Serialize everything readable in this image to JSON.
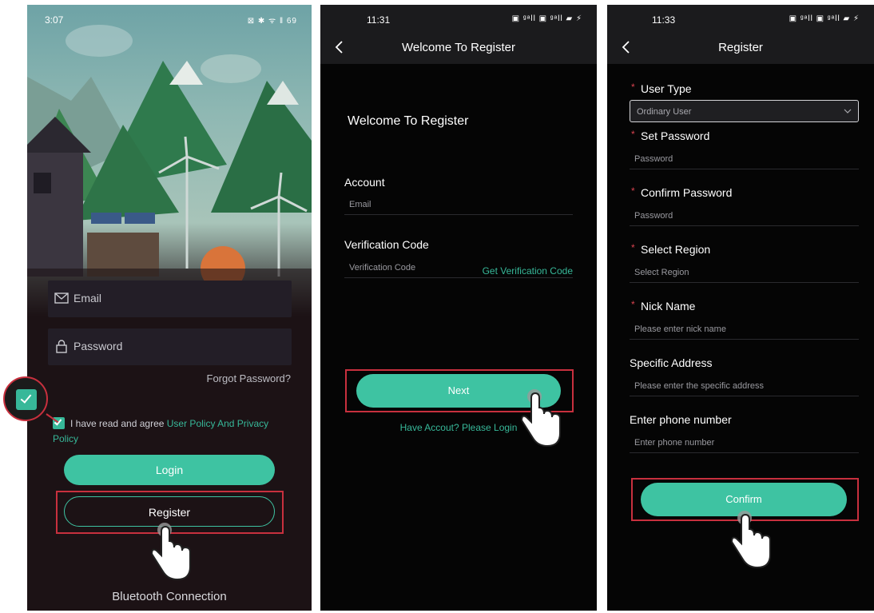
{
  "screen1": {
    "status": {
      "time": "3:07",
      "icons": "⊠ ✱ ᯤ ‖ 69"
    },
    "email_placeholder": "Email",
    "password_placeholder": "Password",
    "forgot": "Forgot Password?",
    "agree_text": "I have read and agree ",
    "agree_link": "User Policy And Privacy Policy",
    "login": "Login",
    "register": "Register",
    "bluetooth": "Bluetooth Connection"
  },
  "screen2": {
    "status": {
      "time": "11:31",
      "icons": "▣ ᵍᵃll ▣ ᵍᵃll ▰ ⚡"
    },
    "header_title": "Welcome To Register",
    "welcome": "Welcome To Register",
    "account_label": "Account",
    "account_placeholder": "Email",
    "code_label": "Verification Code",
    "code_placeholder": "Verification Code",
    "get_code": "Get Verification Code",
    "next": "Next",
    "have_account": "Have Accout? Please Login"
  },
  "screen3": {
    "status": {
      "time": "11:33",
      "icons": "▣ ᵍᵃll ▣ ᵍᵃll ▰ ⚡"
    },
    "header_title": "Register",
    "user_type_label": "User Type",
    "user_type_value": "Ordinary User",
    "set_password_label": "Set Password",
    "set_password_placeholder": "Password",
    "confirm_password_label": "Confirm Password",
    "confirm_password_placeholder": "Password",
    "region_label": "Select Region",
    "region_placeholder": "Select Region",
    "nick_label": "Nick Name",
    "nick_placeholder": "Please enter nick name",
    "address_label": "Specific Address",
    "address_placeholder": "Please enter the specific address",
    "phone_label": "Enter phone number",
    "phone_placeholder": "Enter phone number",
    "confirm": "Confirm",
    "required_mark": "*"
  },
  "colors": {
    "accent": "#3ec3a2",
    "highlight": "#c8303e",
    "required": "#d8434f"
  }
}
